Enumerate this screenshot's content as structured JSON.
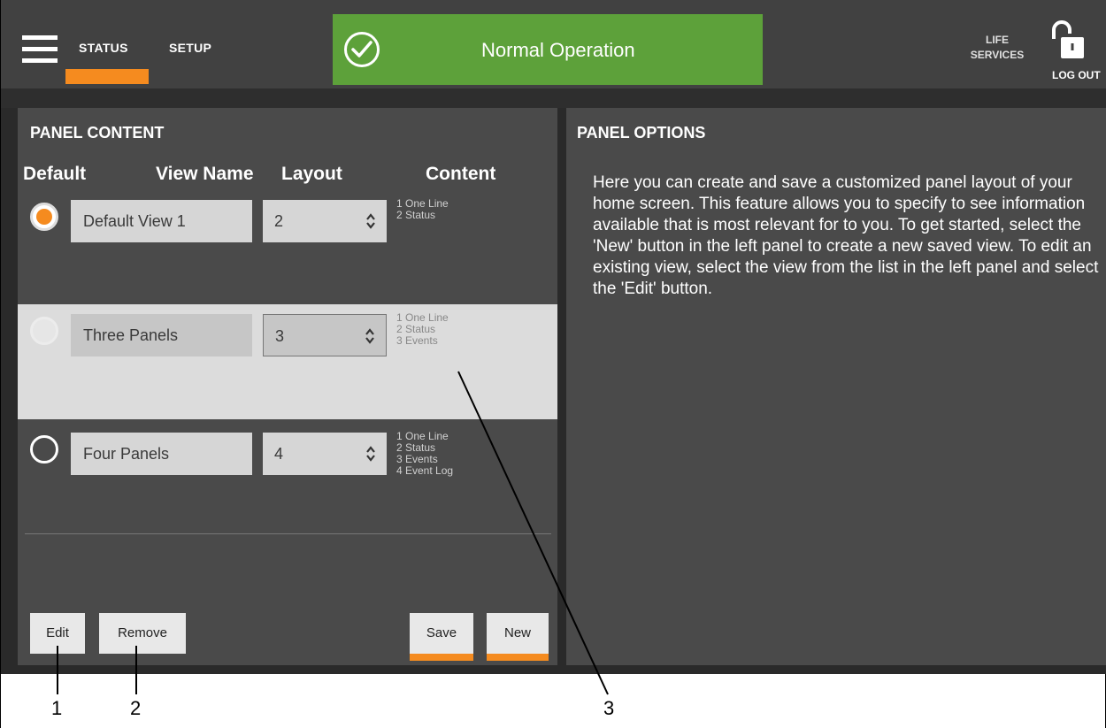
{
  "header": {
    "nav_tabs": [
      {
        "label": "STATUS",
        "active": true
      },
      {
        "label": "SETUP",
        "active": false
      }
    ],
    "status_banner": {
      "text": "Normal Operation",
      "icon": "check-circle-icon",
      "color": "#5da13a"
    },
    "life_services": {
      "line1": "LIFE",
      "line2": "SERVICES"
    },
    "logout": {
      "label": "LOG OUT",
      "icon": "unlock-icon"
    }
  },
  "panel_content": {
    "title": "PANEL CONTENT",
    "columns": {
      "default": "Default",
      "view_name": "View Name",
      "layout": "Layout",
      "content": "Content"
    },
    "rows": [
      {
        "default_selected": true,
        "highlighted": false,
        "view_name": "Default View 1",
        "layout": "2",
        "content": [
          "1 One Line",
          "2 Status"
        ]
      },
      {
        "default_selected": false,
        "highlighted": true,
        "view_name": "Three Panels",
        "layout": "3",
        "content": [
          "1 One Line",
          "2 Status",
          "3 Events"
        ]
      },
      {
        "default_selected": false,
        "highlighted": false,
        "view_name": "Four Panels",
        "layout": "4",
        "content": [
          "1 One Line",
          "2 Status",
          "3 Events",
          "4 Event Log"
        ]
      }
    ],
    "buttons": {
      "edit": "Edit",
      "remove": "Remove",
      "save": "Save",
      "new": "New"
    }
  },
  "panel_options": {
    "title": "PANEL OPTIONS",
    "text": "Here you can create and save a customized panel layout of your home screen. This feature allows you to specify to see information available that is most relevant for to you. To get started, select the 'New' button in the left panel to create a new saved view. To edit an existing view, select the view from the list in the left panel and select the 'Edit' button."
  },
  "callouts": [
    "1",
    "2",
    "3"
  ],
  "colors": {
    "accent": "#f58b1f",
    "status_ok": "#5da13a",
    "panel_bg": "#4a4a4a",
    "header_bg": "#414141"
  }
}
